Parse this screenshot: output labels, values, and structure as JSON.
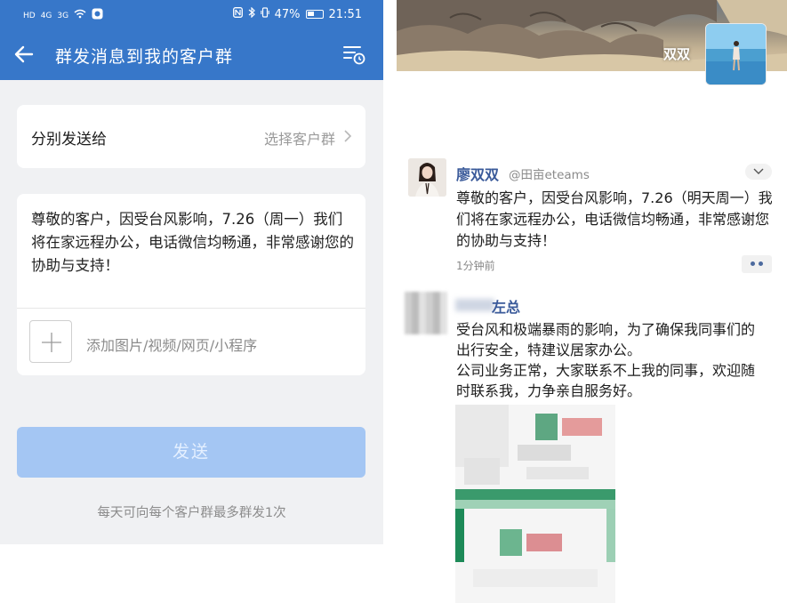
{
  "status_bar": {
    "left_signals": [
      "HD",
      "4G",
      "3G"
    ],
    "battery": "47%",
    "time": "21:51"
  },
  "title_bar": {
    "title": "群发消息到我的客户群"
  },
  "send_to": {
    "label": "分别发送给",
    "value": "选择客户群"
  },
  "message": {
    "text": "尊敬的客户，因受台风影响，7.26（周一）我们将在家远程办公，电话微信均畅通，非常感谢您的协助与支持！",
    "add_label": "添加图片/视频/网页/小程序"
  },
  "send_button": {
    "label": "发送"
  },
  "send_tip": "每天可向每个客户群最多群发1次",
  "feed": {
    "cover_name": "双双",
    "posts": [
      {
        "name": "廖双双",
        "handle": "@田亩eteams",
        "text": "尊敬的客户，因受台风影响，7.26（明天周一）我们将在家远程办公，电话微信均畅通，非常感谢您的协助与支持！",
        "time": "1分钟前"
      },
      {
        "name": "左总",
        "text": "受台风和极端暴雨的影响，为了确保我同事们的出行安全，特建议居家办公。\n公司业务正常，大家联系不上我的同事，欢迎随时联系我，力争亲自服务好。"
      }
    ]
  },
  "colors": {
    "brand_blue": "#3777c9",
    "button_disabled": "#a4c6f3",
    "name_link": "#3a5a9a"
  }
}
